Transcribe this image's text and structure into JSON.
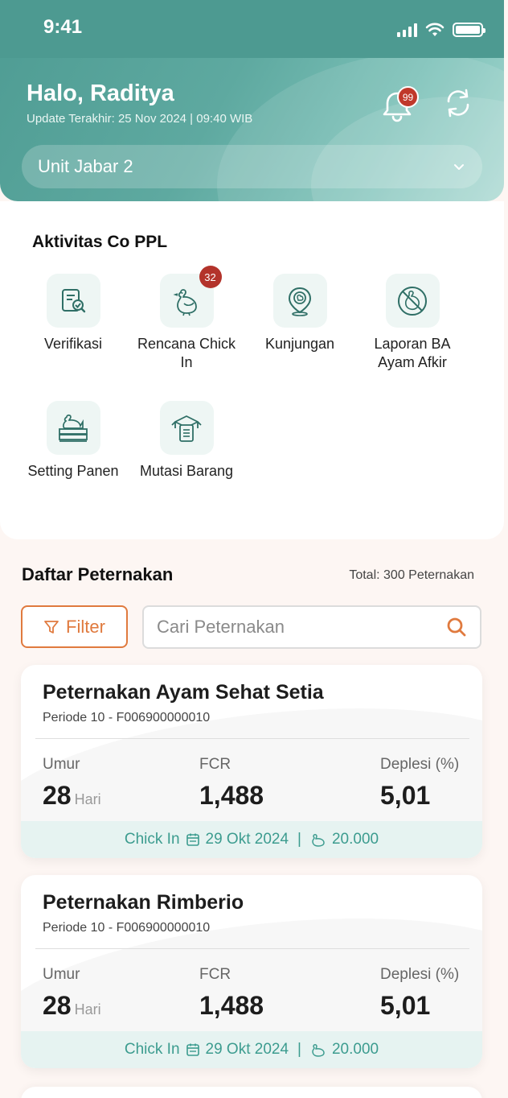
{
  "status_bar": {
    "time": "9:41"
  },
  "header": {
    "greeting": "Halo, Raditya",
    "update_text": "Update Terakhir:  25 Nov 2024 | 09:40 WIB",
    "notification_count": "99",
    "unit_select": {
      "value": "Unit Jabar 2"
    }
  },
  "activity": {
    "title": "Aktivitas Co PPL",
    "items": [
      {
        "label": "Verifikasi",
        "icon": "verification-icon"
      },
      {
        "label": "Rencana Chick In",
        "icon": "chick-icon",
        "badge": "32"
      },
      {
        "label": "Kunjungan",
        "icon": "location-pin-icon"
      },
      {
        "label": "Laporan BA Ayam Afkir",
        "icon": "no-chicken-icon"
      },
      {
        "label": "Setting Panen",
        "icon": "harvest-icon"
      },
      {
        "label": "Mutasi Barang",
        "icon": "box-clipboard-icon"
      }
    ]
  },
  "farm_list": {
    "title": "Daftar Peternakan",
    "total": "Total: 300 Peternakan",
    "filter_label": "Filter",
    "search_placeholder": "Cari Peternakan",
    "farms": [
      {
        "name": "Peternakan Ayam Sehat Setia",
        "period": "Periode 10 - F006900000010",
        "umur_label": "Umur",
        "umur_value": "28",
        "umur_unit": "Hari",
        "fcr_label": "FCR",
        "fcr_value": "1,488",
        "deplesi_label": "Deplesi (%)",
        "deplesi_value": "5,01",
        "chick_in_label": "Chick In",
        "chick_in_date": "29 Okt 2024",
        "separator": "|",
        "population": "20.000"
      },
      {
        "name": "Peternakan Rimberio",
        "period": "Periode 10 - F006900000010",
        "umur_label": "Umur",
        "umur_value": "28",
        "umur_unit": "Hari",
        "fcr_label": "FCR",
        "fcr_value": "1,488",
        "deplesi_label": "Deplesi (%)",
        "deplesi_value": "5,01",
        "chick_in_label": "Chick In",
        "chick_in_date": "29 Okt 2024",
        "separator": "|",
        "population": "20.000"
      }
    ]
  },
  "colors": {
    "primary": "#4e9c93",
    "accent": "#e07a3e",
    "badge": "#c0392b",
    "footer_text": "#3c9c8f"
  }
}
